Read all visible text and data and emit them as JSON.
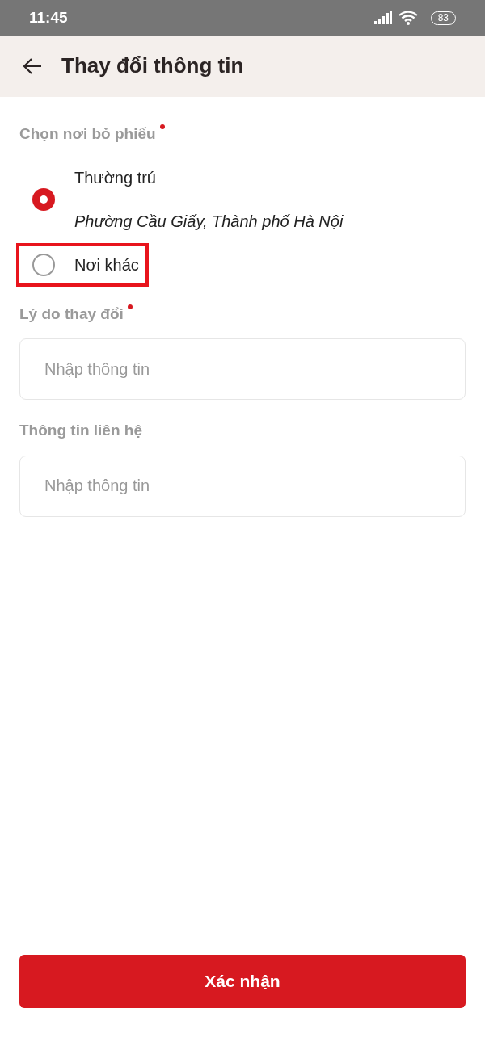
{
  "status_bar": {
    "time": "11:45",
    "battery": "83"
  },
  "app_bar": {
    "title": "Thay đổi thông tin"
  },
  "voting_place": {
    "label": "Chọn nơi bỏ phiếu",
    "required": true,
    "options": [
      {
        "label": "Thường trú",
        "detail": "Phường Cầu Giấy, Thành phố Hà Nội",
        "selected": true,
        "highlighted": false
      },
      {
        "label": "Nơi khác",
        "selected": false,
        "highlighted": true
      }
    ]
  },
  "fields": [
    {
      "label": "Lý do thay đổi",
      "required": true,
      "placeholder": "Nhập thông tin"
    },
    {
      "label": "Thông tin liên hệ",
      "required": false,
      "placeholder": "Nhập thông tin"
    }
  ],
  "submit_button": "Xác nhận"
}
